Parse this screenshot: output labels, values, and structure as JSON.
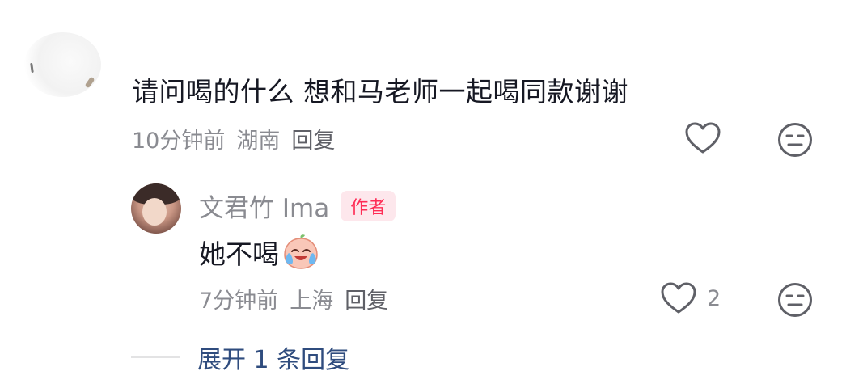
{
  "top_comment": {
    "text": "请问喝的什么 想和马老师一起喝同款谢谢",
    "time": "10分钟前",
    "location": "湖南",
    "reply_label": "回复",
    "like_icon": "heart-outline-icon",
    "dislike_icon": "meh-face-icon"
  },
  "reply": {
    "username": "文君竹 Ima",
    "badge": "作者",
    "text": "她不喝",
    "emoji": "crying-peach-emoji",
    "time": "7分钟前",
    "location": "上海",
    "reply_label": "回复",
    "like_count": "2",
    "like_icon": "heart-outline-icon",
    "dislike_icon": "meh-face-icon"
  },
  "expand": {
    "label": "展开 1 条回复"
  },
  "colors": {
    "primary_text": "#161823",
    "secondary_text": "#8a8b91",
    "author_badge": "#fe2c55",
    "link": "#2f4c7e"
  }
}
